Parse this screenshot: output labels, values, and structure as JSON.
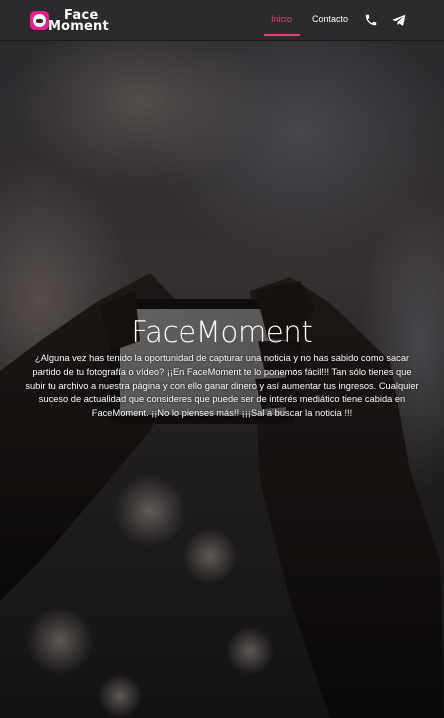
{
  "brand": {
    "line1": "Face",
    "line2": "Moment",
    "logo_icon": "camera-icon"
  },
  "nav": {
    "items": [
      {
        "label": "Inicio",
        "active": true
      },
      {
        "label": "Contacto",
        "active": false
      }
    ],
    "icons": [
      "phone-icon",
      "telegram-icon"
    ]
  },
  "hero": {
    "title": "FaceMoment",
    "text": "¿Alguna vez has tenido la oportunidad de capturar una noticia y no has sabido como sacar partido de tu fotografía o vídeo? ¡¡En FaceMoment te lo ponemos fácil!!! Tan sólo tienes que subir tu archivo a nuestra página y con ello ganar dinero y así aumentar tus ingresos. Cualquier suceso de actualidad que consideres que puede ser de interés mediático tiene cabida en FaceMoment. ¡¡No lo pienses más!! ¡¡¡Sal a buscar la noticia !!!"
  },
  "colors": {
    "accent": "#e5407a",
    "navbar": "#2b2b2e",
    "logo": "#e91e8c"
  }
}
